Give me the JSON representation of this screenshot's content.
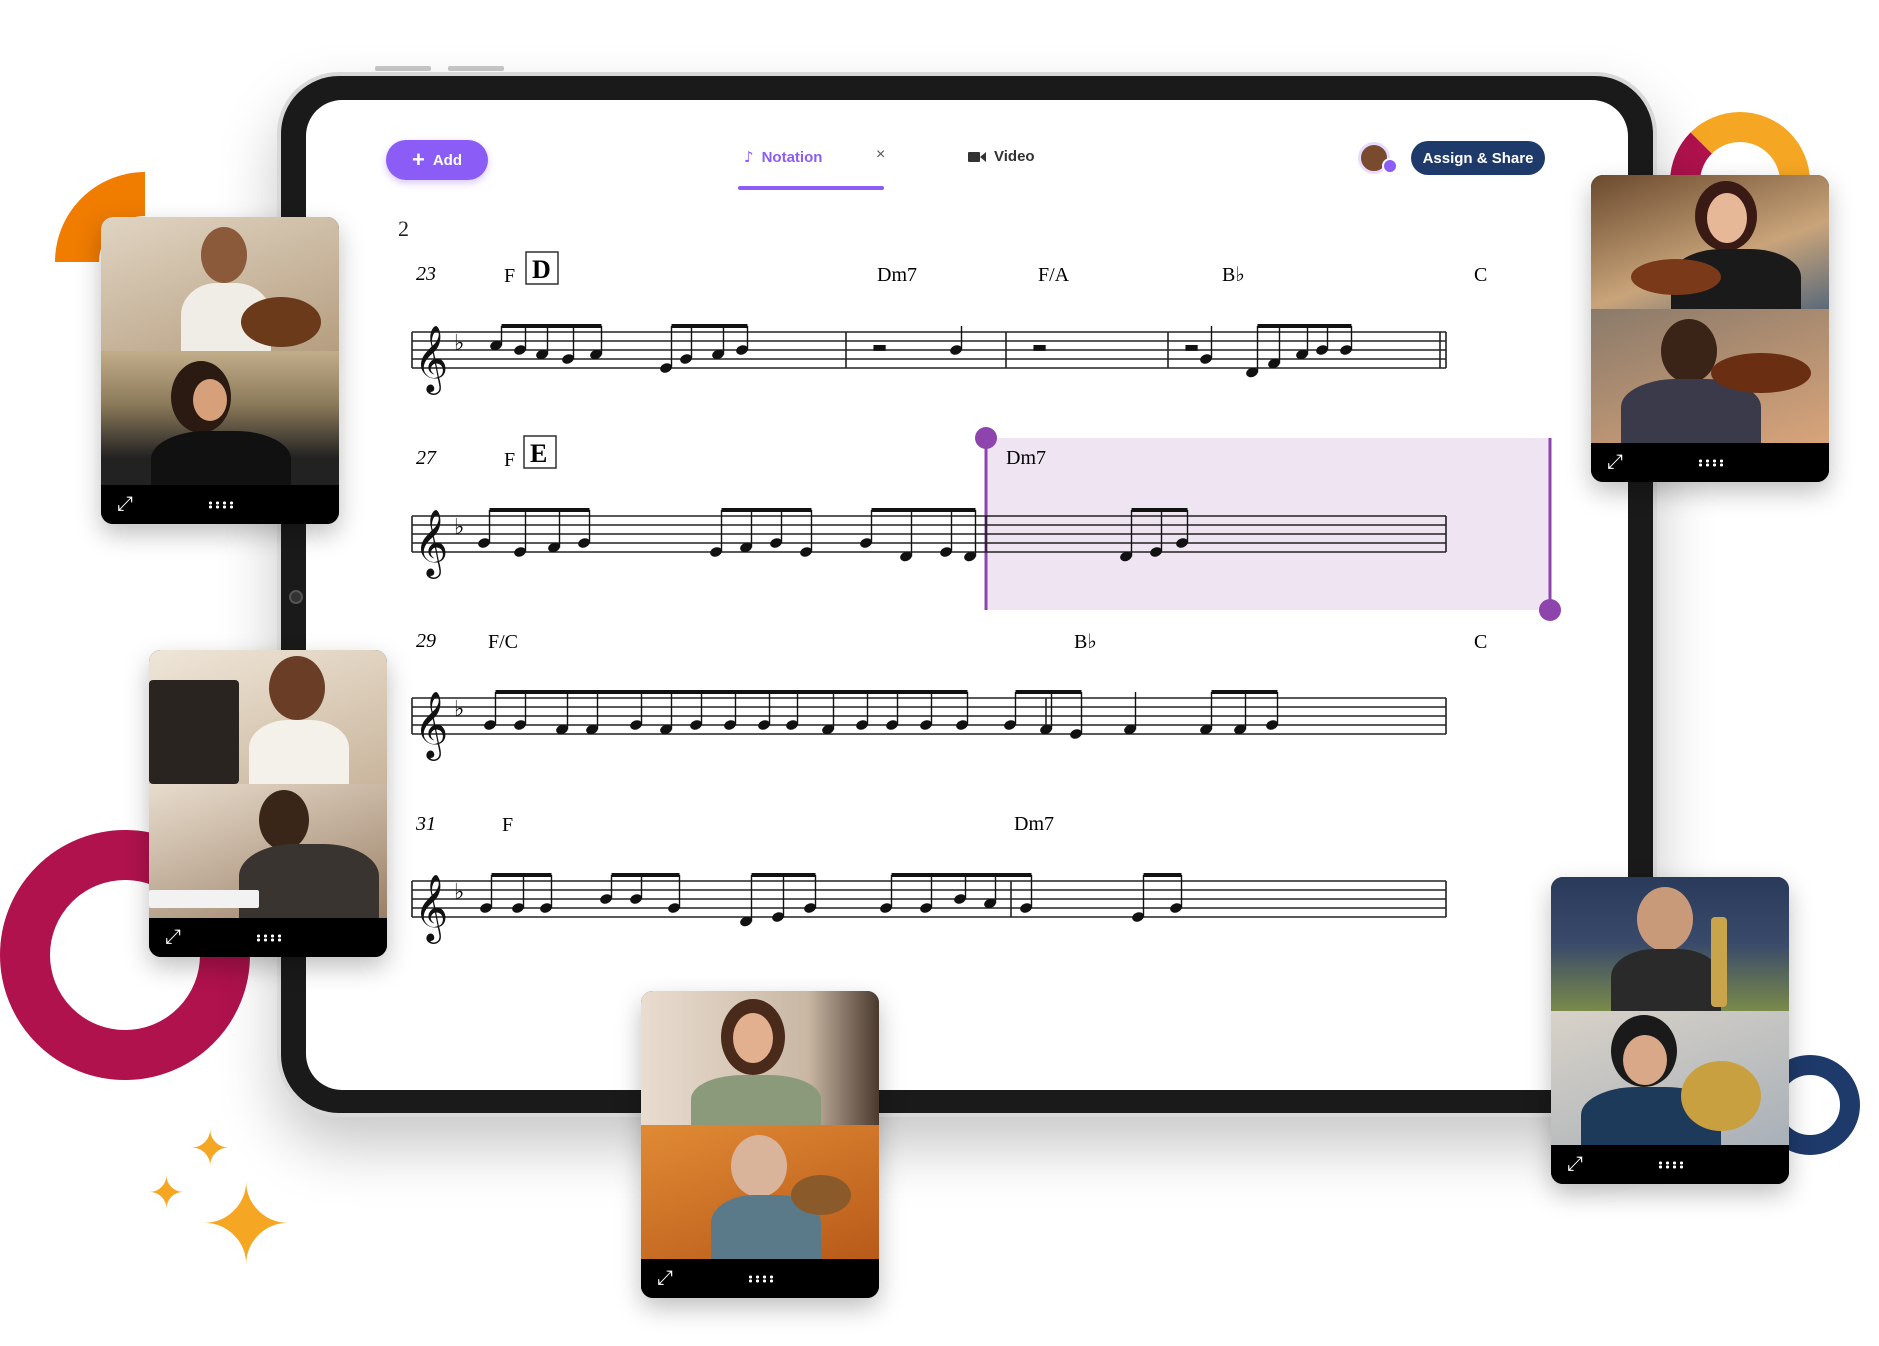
{
  "toolbar": {
    "add_label": "Add",
    "tabs": [
      {
        "label": "Notation",
        "active": true,
        "icon": "music-note-icon"
      },
      {
        "label": "Video",
        "active": false,
        "icon": "video-camera-icon"
      }
    ],
    "close_symbol": "×",
    "assign_label": "Assign & Share"
  },
  "score": {
    "page_number": "2",
    "systems": [
      {
        "measure": "23",
        "rehearsal": "D",
        "chords": [
          "F",
          "Dm7",
          "F/A",
          "B♭",
          "C"
        ]
      },
      {
        "measure": "27",
        "rehearsal": "E",
        "chords": [
          "F",
          "Dm7"
        ]
      },
      {
        "measure": "29",
        "rehearsal": "",
        "chords": [
          "F/C",
          "B♭",
          "C"
        ]
      },
      {
        "measure": "31",
        "rehearsal": "",
        "chords": [
          "F",
          "Dm7"
        ]
      }
    ]
  },
  "video_cards": [
    {
      "name": "guitar-lesson",
      "colors": [
        "#c8b49a",
        "#9a8a6a"
      ]
    },
    {
      "name": "piano-lesson",
      "colors": [
        "#d9c7b0",
        "#5a4636"
      ]
    },
    {
      "name": "ukulele-lesson",
      "colors": [
        "#d8c6b2",
        "#d87a2a"
      ]
    },
    {
      "name": "violin-lesson",
      "colors": [
        "#8a6a4a",
        "#6a5a4a"
      ]
    },
    {
      "name": "trombone-lesson",
      "colors": [
        "#2a3a5a",
        "#c9c2b8"
      ]
    }
  ],
  "colors": {
    "accent": "#8b5cf6",
    "navy": "#1e3a6b",
    "selection": "#eee4f2",
    "orange": "#f07c00",
    "magenta": "#b0124d",
    "gold": "#f5a623"
  }
}
